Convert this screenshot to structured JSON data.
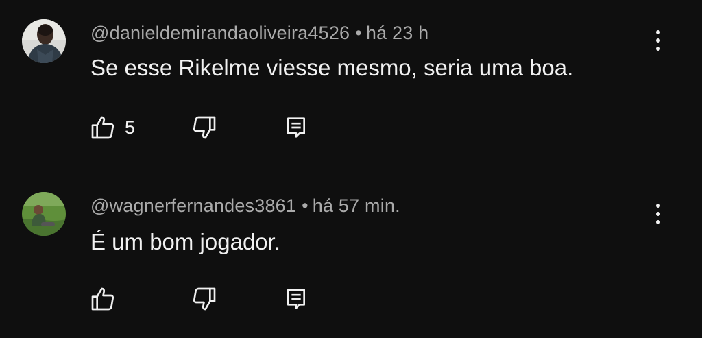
{
  "comments": [
    {
      "author": "@danieldemirandaoliveira4526",
      "separator": "•",
      "time": "há 23 h",
      "text": "Se esse Rikelme viesse mesmo, seria uma boa.",
      "likes": "5"
    },
    {
      "author": "@wagnerfernandes3861",
      "separator": "•",
      "time": "há 57 min.",
      "text": "É um bom jogador.",
      "likes": ""
    }
  ],
  "icons": {
    "like": "thumbs-up-icon",
    "dislike": "thumbs-down-icon",
    "reply": "reply-comment-icon",
    "menu": "more-vertical-icon"
  },
  "colors": {
    "background": "#0f0f0f",
    "primary_text": "#f1f1f1",
    "secondary_text": "#aaaaaa"
  }
}
